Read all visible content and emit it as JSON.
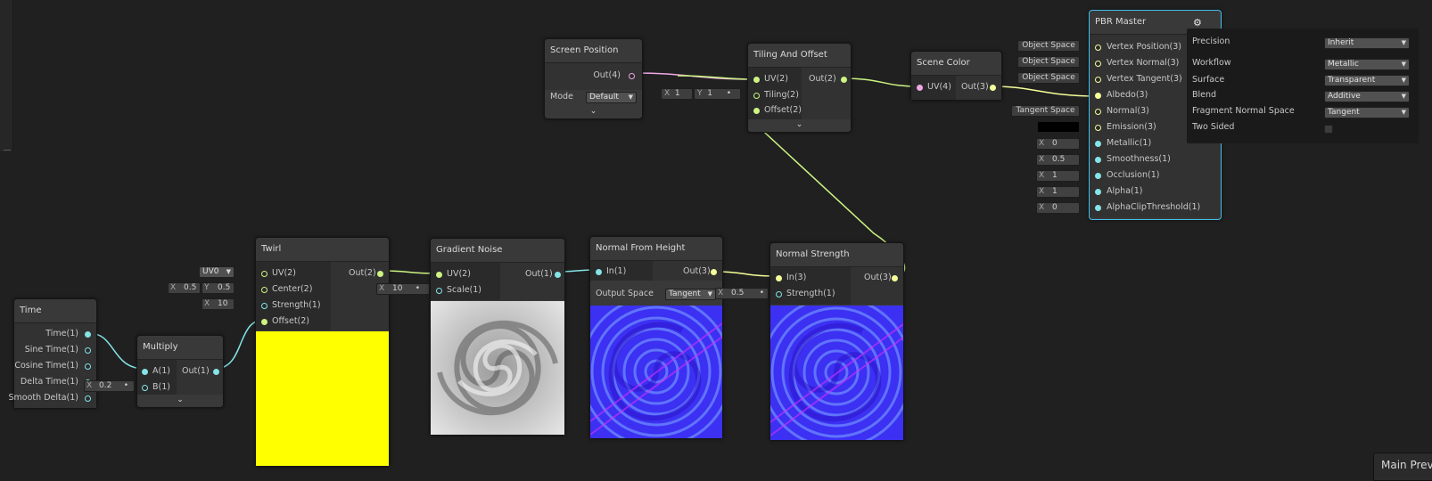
{
  "colors": {
    "background": "#202020",
    "node": "#393939",
    "selection": "#44c0ea",
    "vector1": "#84e4e7",
    "vector2": "#cdf483",
    "vector3": "#f6ff9a",
    "vector4": "#f0a7e5",
    "twirl_preview": "#ffff00"
  },
  "nodes": {
    "screen_position": {
      "title": "Screen Position",
      "out": "Out(4)",
      "mode_label": "Mode",
      "mode_value": "Default"
    },
    "tiling": {
      "title": "Tiling And Offset",
      "uv": "UV(2)",
      "tiling": "Tiling(2)",
      "offset": "Offset(2)",
      "out": "Out(2)",
      "x_label": "X",
      "x_value": "1",
      "y_label": "Y",
      "y_value": "1"
    },
    "scene_color": {
      "title": "Scene Color",
      "uv": "UV(4)",
      "out": "Out(3)"
    },
    "pbr": {
      "title": "PBR Master",
      "gear_icon": "gear-icon",
      "ports": [
        "Vertex Position(3)",
        "Vertex Normal(3)",
        "Vertex Tangent(3)",
        "Albedo(3)",
        "Normal(3)",
        "Emission(3)",
        "Metallic(1)",
        "Smoothness(1)",
        "Occlusion(1)",
        "Alpha(1)",
        "AlphaClipThreshold(1)"
      ],
      "inputs": {
        "vpos": "Object Space",
        "vnorm": "Object Space",
        "vtan": "Object Space",
        "normal": "Tangent Space",
        "metallic": "0",
        "smoothness": "0.5",
        "occlusion": "1",
        "alpha": "1",
        "clip": "0",
        "x": "X"
      }
    },
    "settings": {
      "precision_label": "Precision",
      "precision_value": "Inherit",
      "workflow_label": "Workflow",
      "workflow_value": "Metallic",
      "surface_label": "Surface",
      "surface_value": "Transparent",
      "blend_label": "Blend",
      "blend_value": "Additive",
      "fns_label": "Fragment Normal Space",
      "fns_value": "Tangent",
      "two_sided_label": "Two Sided"
    },
    "time": {
      "title": "Time",
      "ports": [
        "Time(1)",
        "Sine Time(1)",
        "Cosine Time(1)",
        "Delta Time(1)",
        "Smooth Delta(1)"
      ]
    },
    "multiply": {
      "title": "Multiply",
      "a": "A(1)",
      "b": "B(1)",
      "out": "Out(1)",
      "b_x": "X",
      "b_value": "0.2"
    },
    "twirl": {
      "title": "Twirl",
      "uv": "UV(2)",
      "center": "Center(2)",
      "strength": "Strength(1)",
      "offset": "Offset(2)",
      "out": "Out(2)",
      "uv_value": "UV0",
      "cx_label": "X",
      "cx_value": "0.5",
      "cy_label": "Y",
      "cy_value": "0.5",
      "s_label": "X",
      "s_value": "10"
    },
    "gradient": {
      "title": "Gradient Noise",
      "uv": "UV(2)",
      "scale": "Scale(1)",
      "out": "Out(1)",
      "s_label": "X",
      "s_value": "10"
    },
    "nfh": {
      "title": "Normal From Height",
      "in": "In(1)",
      "out": "Out(3)",
      "space_label": "Output Space",
      "space_value": "Tangent"
    },
    "nstrength": {
      "title": "Normal Strength",
      "in": "In(3)",
      "strength": "Strength(1)",
      "out": "Out(3)",
      "s_label": "X",
      "s_value": "0.5"
    }
  },
  "main_preview": {
    "label": "Main Preview"
  }
}
